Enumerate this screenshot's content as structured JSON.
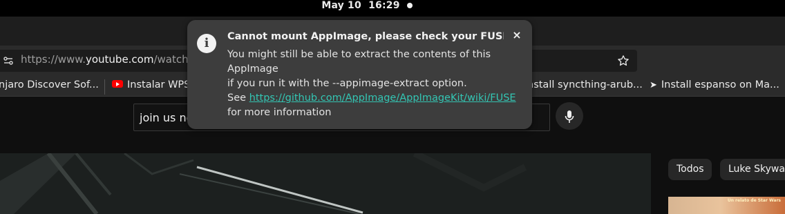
{
  "topbar": {
    "date": "May 10",
    "time": "16:29"
  },
  "browser": {
    "url_prefix": "https://www.",
    "url_domain": "youtube.com",
    "url_rest": "/watch?",
    "bookmarks": [
      {
        "label": "njaro Discover Sof...",
        "icon": "none"
      },
      {
        "label": "Instalar WPS",
        "icon": "youtube-icon"
      },
      {
        "label": "nstall syncthing-arub...",
        "icon": "none"
      },
      {
        "label": "Install espanso on Ma...",
        "icon": "arrow-icon"
      }
    ]
  },
  "youtube": {
    "search_value": "join us no",
    "chips": [
      "Todos",
      "Luke Skywalk"
    ],
    "thumb_text": "Un relato de Star Wars"
  },
  "notification": {
    "title": "Cannot mount AppImage, please check your FUSE s...",
    "close_label": "×",
    "icon": "info-icon",
    "body_line1": "You might still be able to extract the contents of this",
    "body_line2": "AppImage",
    "body_line3": "if you run it with the --appimage-extract option.",
    "see_label": "See ",
    "link": "https://github.com/AppImage/AppImageKit/wiki/FUSE",
    "body_line5": "for more information"
  },
  "colors": {
    "notification_bg": "#3d3d3d",
    "link": "#33c6b4",
    "youtube_red": "#ff0000"
  }
}
